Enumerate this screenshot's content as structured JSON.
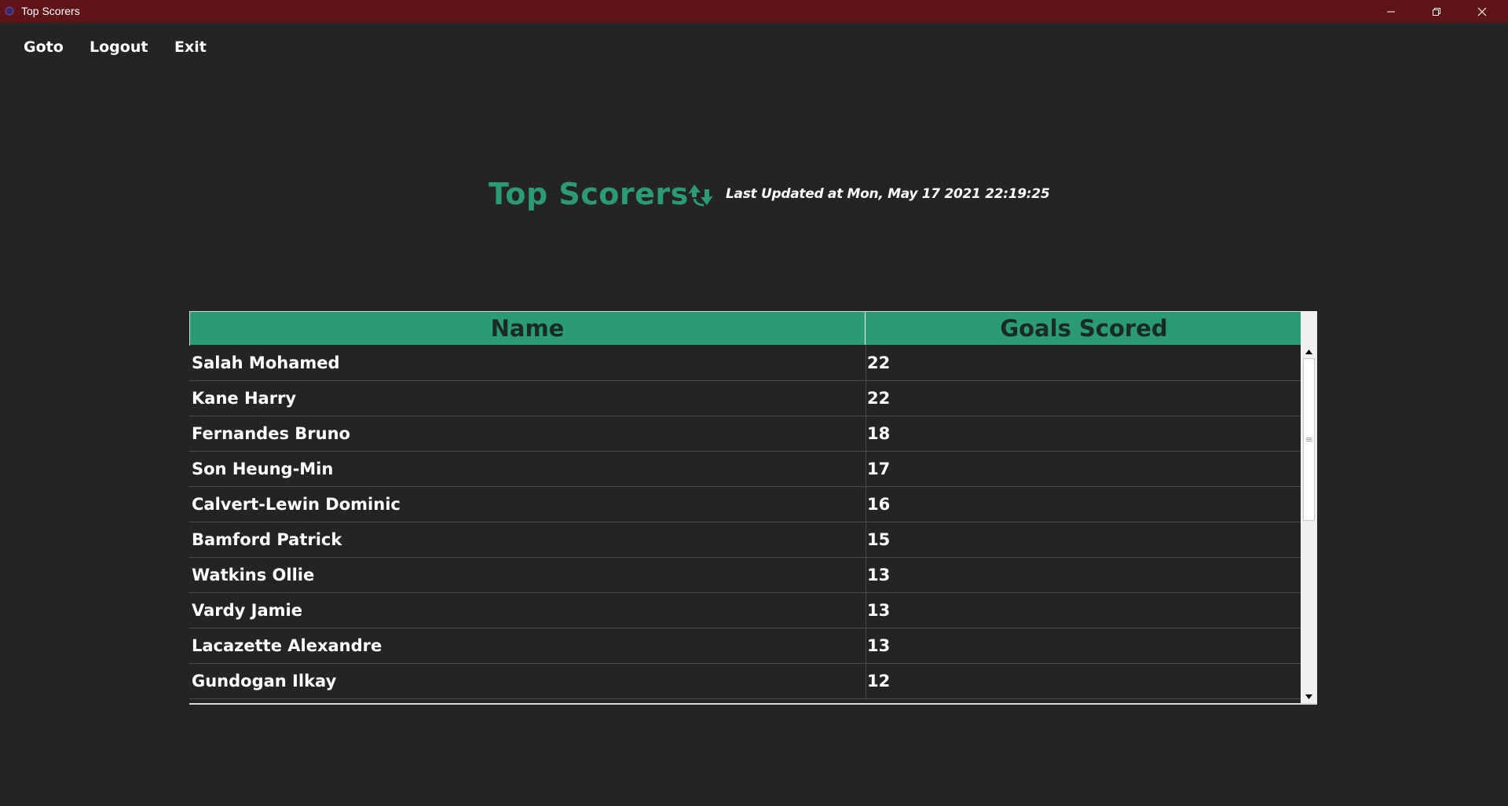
{
  "window": {
    "title": "Top Scorers",
    "controls": [
      "minimize",
      "restore",
      "close"
    ]
  },
  "menu": {
    "items": [
      {
        "label": "Goto"
      },
      {
        "label": "Logout"
      },
      {
        "label": "Exit"
      }
    ]
  },
  "header": {
    "title": "Top Scorers",
    "refresh_icon": "refresh-icon",
    "last_updated": "Last Updated at Mon, May 17 2021 22:19:25"
  },
  "table": {
    "columns": [
      "Name",
      "Goals Scored"
    ],
    "rows": [
      {
        "name": "Salah Mohamed",
        "goals": "22"
      },
      {
        "name": "Kane Harry",
        "goals": "22"
      },
      {
        "name": "Fernandes Bruno",
        "goals": "18"
      },
      {
        "name": "Son Heung-Min",
        "goals": "17"
      },
      {
        "name": "Calvert-Lewin Dominic",
        "goals": "16"
      },
      {
        "name": "Bamford Patrick",
        "goals": "15"
      },
      {
        "name": "Watkins Ollie",
        "goals": "13"
      },
      {
        "name": "Vardy Jamie",
        "goals": "13"
      },
      {
        "name": "Lacazette Alexandre",
        "goals": "13"
      },
      {
        "name": "Gundogan Ilkay",
        "goals": "12"
      }
    ]
  },
  "colors": {
    "titlebar": "#5e1416",
    "background": "#242424",
    "accent": "#2b9a76",
    "text": "#ffffff"
  }
}
